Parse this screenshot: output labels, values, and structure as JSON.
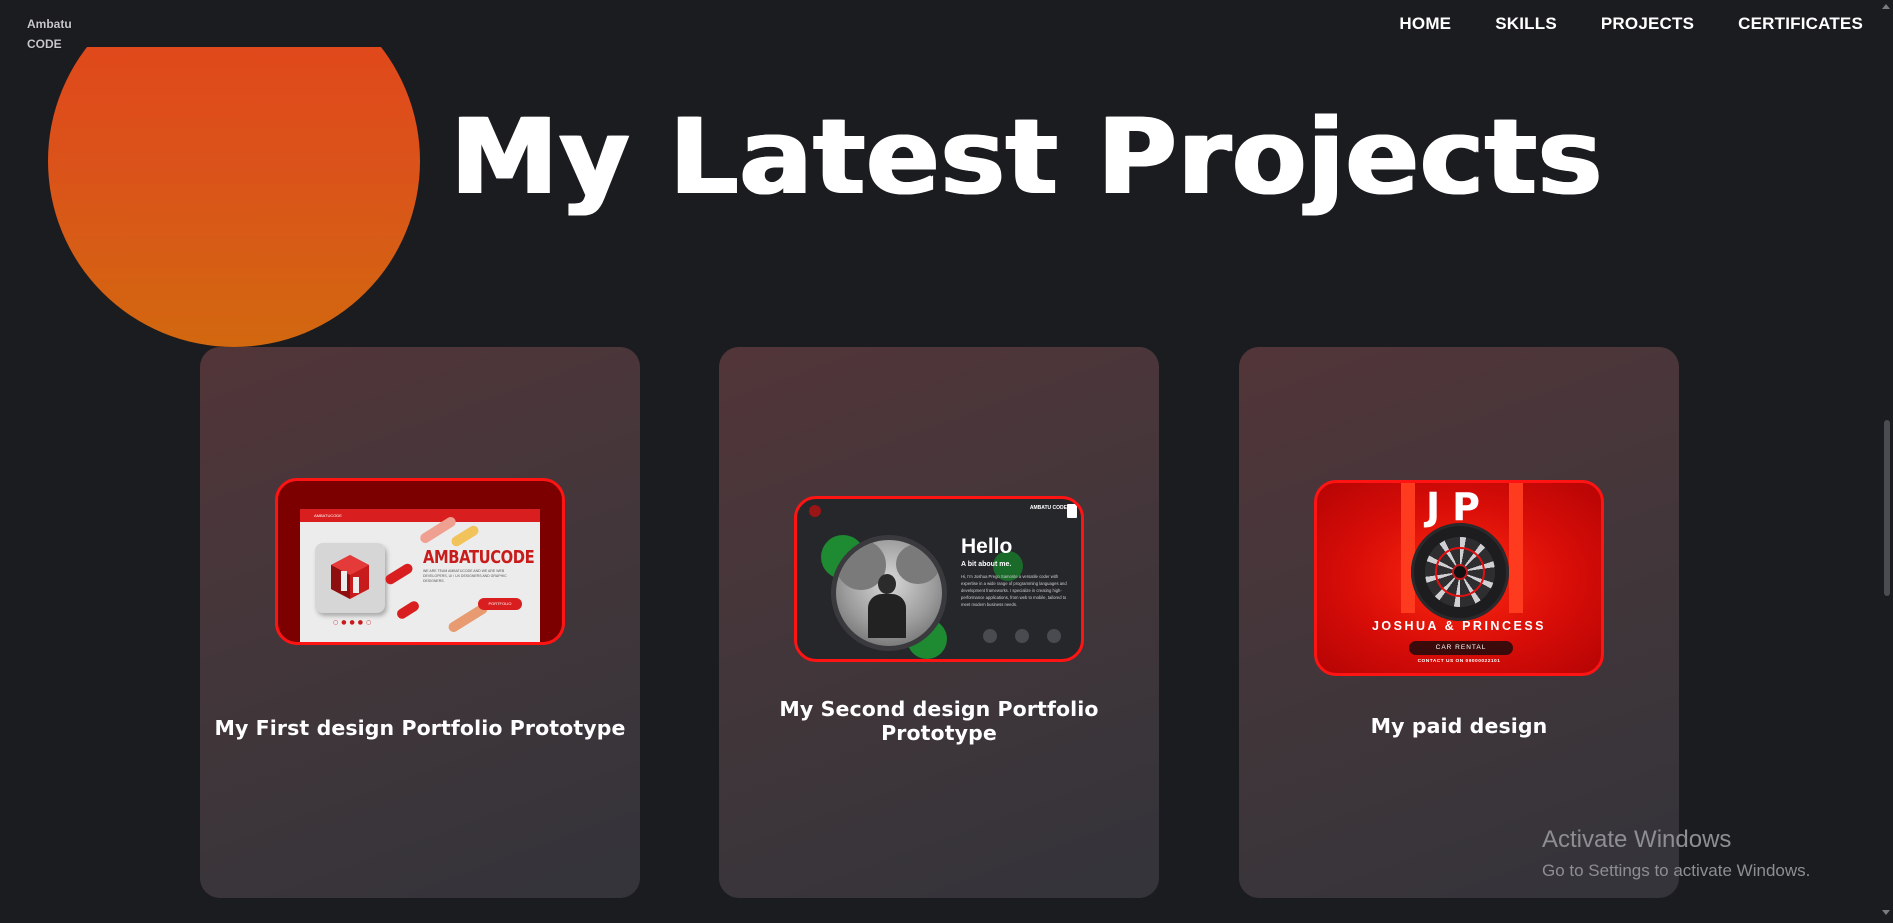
{
  "logo": {
    "line1": "Ambatu",
    "line2": "CODE"
  },
  "nav": [
    {
      "label": "HOME"
    },
    {
      "label": "SKILLS"
    },
    {
      "label": "PROJECTS"
    },
    {
      "label": "CERTIFICATES"
    }
  ],
  "heading": "My Latest Projects",
  "projects": [
    {
      "title": "My First design Portfolio Prototype",
      "thumb": {
        "brand": "AMBATUCODE",
        "headline": "AMBATUCODE",
        "body": "WE ARE TEAM AMBATUCODE AND WE ARE WEB DEVELOPERS, UI / UX DESIGNERS AND GRAPHIC DESIGNERS.",
        "button": "PORTFOLIO"
      }
    },
    {
      "title": "My Second design Portfolio Prototype",
      "thumb": {
        "corner": "AMBATU CODE",
        "hello": "Hello",
        "sub": "A bit about me.",
        "body": "Hi, I'm Joshua Prego Samonte a versatile coder with expertise in a wide range of programming languages and development frameworks. I specialize in creating high-performance applications, from web to mobile, tailored to meet modern business needs."
      }
    },
    {
      "title": "My paid design",
      "thumb": {
        "initials": "JP",
        "name": "JOSHUA & PRINCESS",
        "tag": "CAR RENTAL",
        "contact": "CONTACT US ON 09000022101"
      }
    }
  ],
  "watermark": {
    "title": "Activate Windows",
    "subtitle": "Go to Settings to activate Windows."
  },
  "colors": {
    "background": "#1b1c20",
    "accent": "#e3431c",
    "card": "#523539",
    "thumb_border": "#ff1414"
  }
}
